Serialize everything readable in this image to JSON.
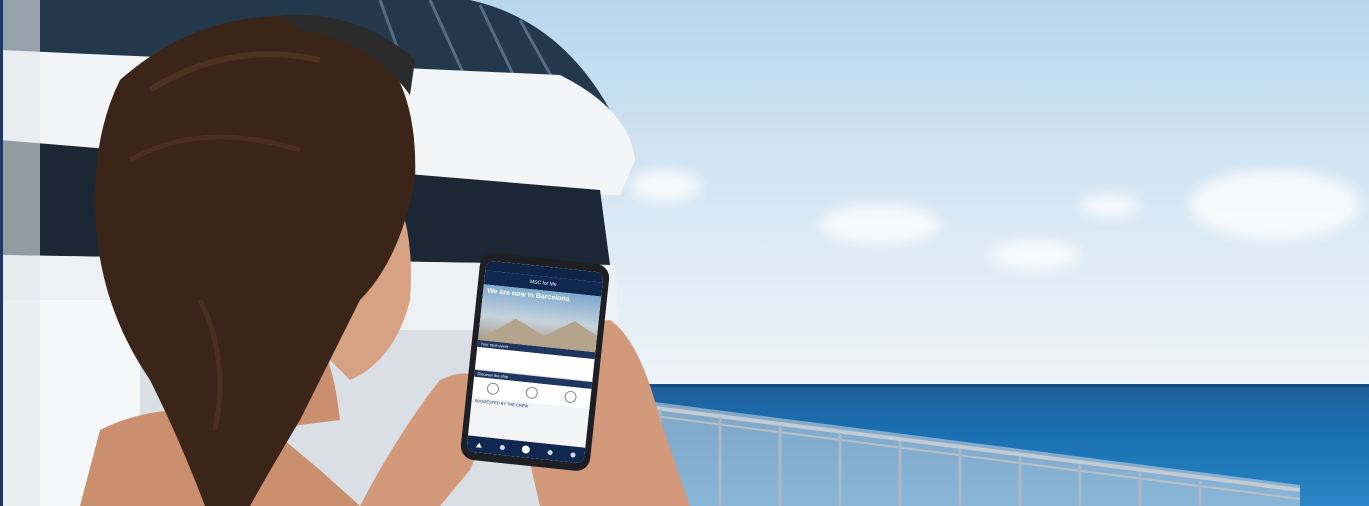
{
  "scene": {
    "colors": {
      "sky_top": "#b7d6ee",
      "sea": "#1a6fb0",
      "ship_hull": "#f2f4f6",
      "ship_glass": "#1d2b3a",
      "hair": "#3b2418",
      "skin": "#d9a585",
      "phone_ui_navy": "#10284f"
    }
  },
  "phone_app": {
    "header_brand": "MSC for Me",
    "hero_title": "We are now in Barcelona",
    "bar_1": "Your next event",
    "bar_2": "Discover the ship",
    "section": "SUGGESTED BY THE CREW",
    "nav_icons": [
      "home-icon",
      "clock-icon",
      "center-logo-icon",
      "explore-icon",
      "ship-icon"
    ]
  }
}
